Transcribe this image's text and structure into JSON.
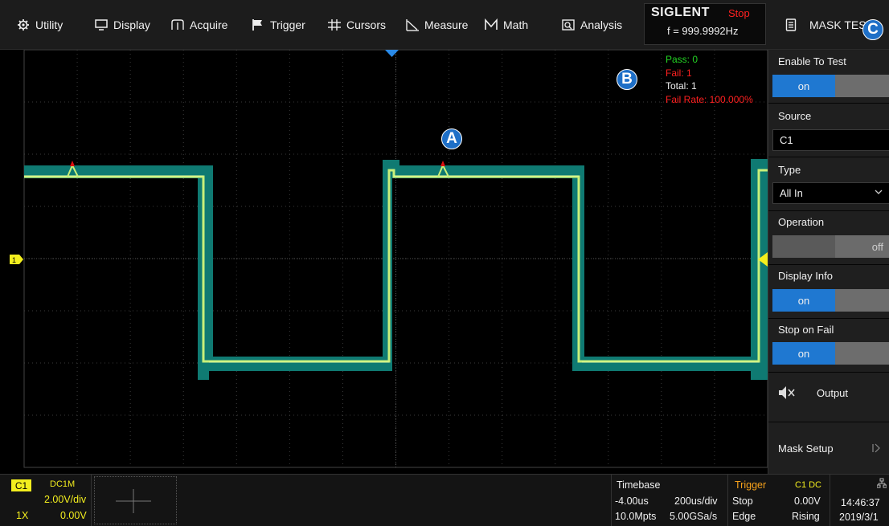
{
  "menu": [
    {
      "label": "Utility",
      "icon": "gear-icon"
    },
    {
      "label": "Display",
      "icon": "monitor-icon"
    },
    {
      "label": "Acquire",
      "icon": "acquire-icon"
    },
    {
      "label": "Trigger",
      "icon": "flag-icon"
    },
    {
      "label": "Cursors",
      "icon": "cursors-icon"
    },
    {
      "label": "Measure",
      "icon": "measure-icon"
    },
    {
      "label": "Math",
      "icon": "math-icon"
    },
    {
      "label": "Analysis",
      "icon": "analysis-icon"
    }
  ],
  "brand": {
    "logo": "SIGLENT",
    "run_state": "Stop",
    "frequency": "f = 999.9992Hz"
  },
  "panel": {
    "title": "MASK TEST",
    "enable_to_test": {
      "label": "Enable To Test",
      "value": "on"
    },
    "source": {
      "label": "Source",
      "value": "C1"
    },
    "type": {
      "label": "Type",
      "value": "All In"
    },
    "operation": {
      "label": "Operation",
      "value": "off"
    },
    "display_info": {
      "label": "Display Info",
      "value": "on"
    },
    "stop_on_fail": {
      "label": "Stop on Fail",
      "value": "on"
    },
    "output": {
      "label": "Output"
    },
    "mask_setup": {
      "label": "Mask Setup"
    }
  },
  "stats": {
    "pass": "Pass: 0",
    "fail": "Fail: 1",
    "total": "Total: 1",
    "fail_rate": "Fail Rate: 100.000%"
  },
  "callouts": {
    "a": "A",
    "b": "B",
    "c": "C"
  },
  "channel": {
    "name": "C1",
    "coupling": "DC1M",
    "scale": "2.00V/div",
    "probe": "1X",
    "offset": "0.00V"
  },
  "timebase": {
    "label": "Timebase",
    "delay": "-4.00us",
    "scale": "200us/div",
    "mem": "10.0Mpts",
    "rate": "5.00GSa/s"
  },
  "trigger": {
    "label": "Trigger",
    "source": "C1 DC",
    "state": "Stop",
    "level": "0.00V",
    "type": "Edge",
    "slope": "Rising"
  },
  "clock": {
    "time": "14:46:37",
    "date": "2019/3/1"
  },
  "colors": {
    "accent": "#1f78d1",
    "trace": "#c8f07a",
    "mask": "#0f7a72",
    "pass": "#23d323",
    "fail": "#ff2020",
    "channel": "#f3ee1e",
    "trigger": "#f7a21b"
  }
}
